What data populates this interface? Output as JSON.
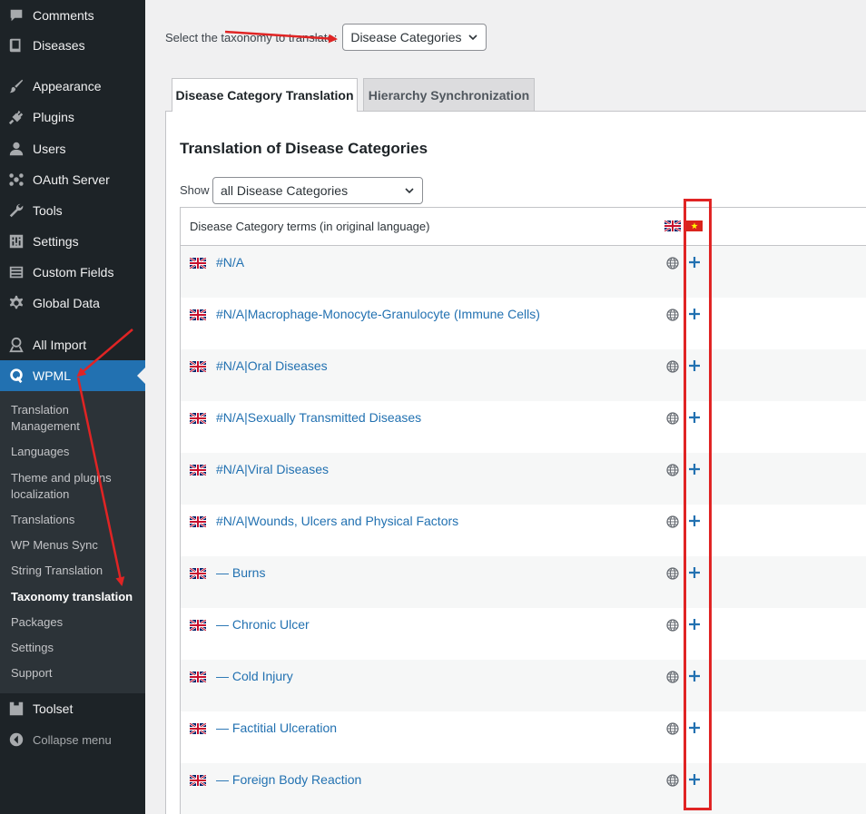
{
  "sidebar": {
    "items": [
      {
        "label": "Comments",
        "icon": "comment-icon"
      },
      {
        "label": "Diseases",
        "icon": "book-icon"
      },
      {
        "label": "Appearance",
        "icon": "paintbrush-icon"
      },
      {
        "label": "Plugins",
        "icon": "plugin-icon"
      },
      {
        "label": "Users",
        "icon": "users-icon"
      },
      {
        "label": "OAuth Server",
        "icon": "network-icon"
      },
      {
        "label": "Tools",
        "icon": "wrench-icon"
      },
      {
        "label": "Settings",
        "icon": "settings-icon"
      },
      {
        "label": "Custom Fields",
        "icon": "fields-icon"
      },
      {
        "label": "Global Data",
        "icon": "gear-icon"
      },
      {
        "label": "All Import",
        "icon": "import-icon"
      },
      {
        "label": "WPML",
        "icon": "wpml-icon"
      },
      {
        "label": "Toolset",
        "icon": "toolset-icon"
      },
      {
        "label": "Collapse menu",
        "icon": "collapse-icon"
      }
    ],
    "submenu": [
      "Translation Management",
      "Languages",
      "Theme and plugins localization",
      "Translations",
      "WP Menus Sync",
      "String Translation",
      "Taxonomy translation",
      "Packages",
      "Settings",
      "Support"
    ],
    "current_submenu": "Taxonomy translation",
    "accent_color": "#2271b1",
    "background_color": "#1d2327"
  },
  "taxonomy": {
    "label": "Select the taxonomy to translate:",
    "selected": "Disease Categories"
  },
  "tabs": [
    {
      "label": "Disease Category Translation",
      "active": true
    },
    {
      "label": "Hierarchy Synchronization",
      "active": false
    }
  ],
  "section_title": "Translation of Disease Categories",
  "filter": {
    "label": "Show",
    "selected": "all Disease Categories"
  },
  "table": {
    "header": "Disease Category terms (in original language)",
    "languages": [
      "English",
      "Vietnamese"
    ],
    "rows": [
      "#N/A",
      "#N/A|Macrophage-Monocyte-Granulocyte (Immune Cells)",
      "#N/A|Oral Diseases",
      "#N/A|Sexually Transmitted Diseases",
      "#N/A|Viral Diseases",
      "#N/A|Wounds, Ulcers and Physical Factors",
      "— Burns",
      "— Chronic Ulcer",
      "— Cold Injury",
      "— Factitial Ulceration",
      "— Foreign Body Reaction"
    ],
    "link_color": "#2271b1"
  },
  "annotation_color": "#e02424"
}
